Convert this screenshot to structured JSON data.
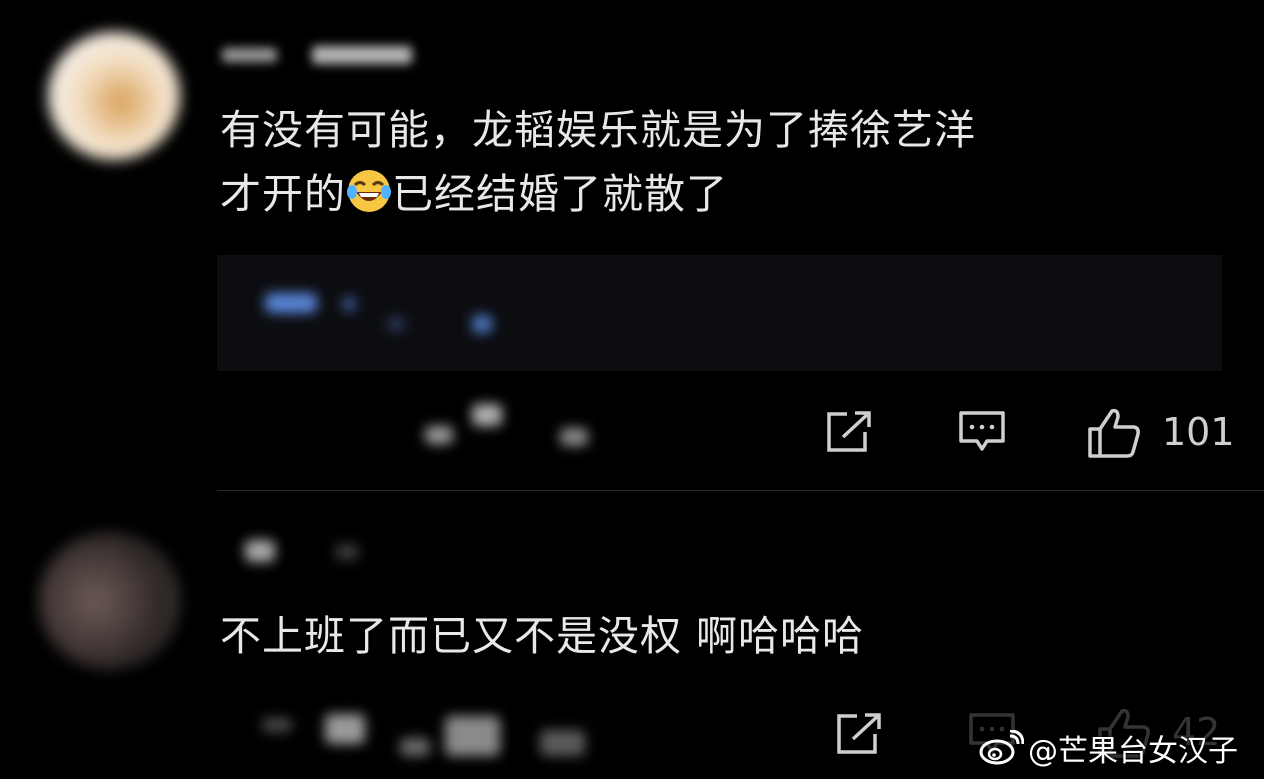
{
  "comments": [
    {
      "text_line1": "有没有可能，龙韬娱乐就是为了捧徐艺洋",
      "text_line2_before_emoji": "才开的",
      "emoji": "laughing-tears-emoji",
      "text_line2_after_emoji": "已经结婚了就散了",
      "like_count": "101",
      "icons": [
        "share-icon",
        "reply-icon",
        "thumbs-up-icon"
      ]
    },
    {
      "text": "不上班了而已又不是没权 啊哈哈哈",
      "like_count": "42",
      "icons": [
        "share-icon",
        "reply-icon",
        "thumbs-up-icon"
      ]
    }
  ],
  "watermark": {
    "icon": "weibo-logo-icon",
    "text": "@芒果台女汉子"
  },
  "colors": {
    "background": "#000000",
    "text": "#e8e8e8",
    "icon": "#cfcfcf",
    "reply_box": "#0c0d11"
  }
}
